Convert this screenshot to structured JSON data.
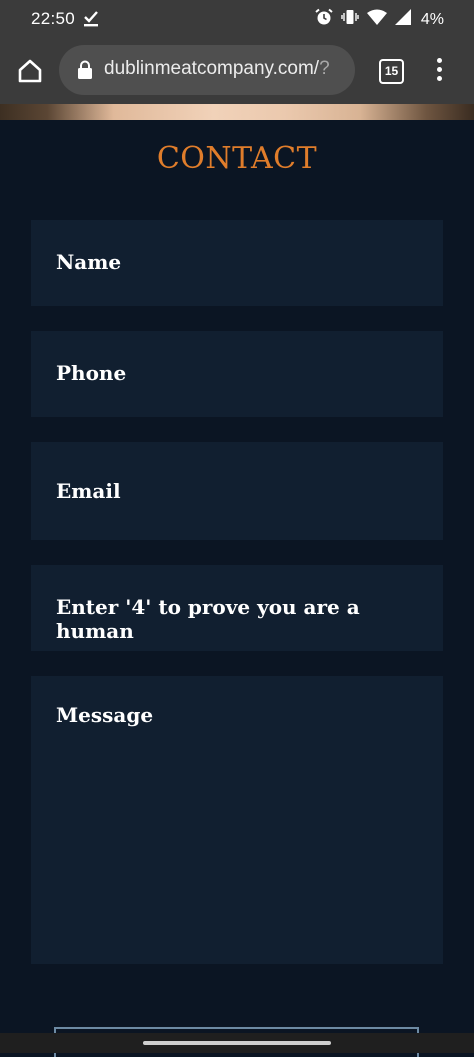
{
  "status_bar": {
    "time": "22:50",
    "battery_percent": "4%",
    "icons": [
      "download-done-icon",
      "alarm-icon",
      "vibrate-icon",
      "wifi-icon",
      "signal-icon",
      "battery-icon"
    ]
  },
  "browser": {
    "url_main": "dublinmeatcompany.com/",
    "url_tail": "?",
    "tab_count": "15",
    "icons": [
      "home-icon",
      "lock-icon",
      "tabs-icon",
      "more-vert-icon"
    ]
  },
  "contact": {
    "title": "CONTACT",
    "fields": {
      "name_placeholder": "Name",
      "phone_placeholder": "Phone",
      "email_placeholder": "Email",
      "captcha_placeholder": "Enter '4' to prove you are a human",
      "message_placeholder": "Message"
    }
  },
  "colors": {
    "page_background": "#0b1523",
    "field_background": "#111f30",
    "accent": "#e07d2b"
  }
}
